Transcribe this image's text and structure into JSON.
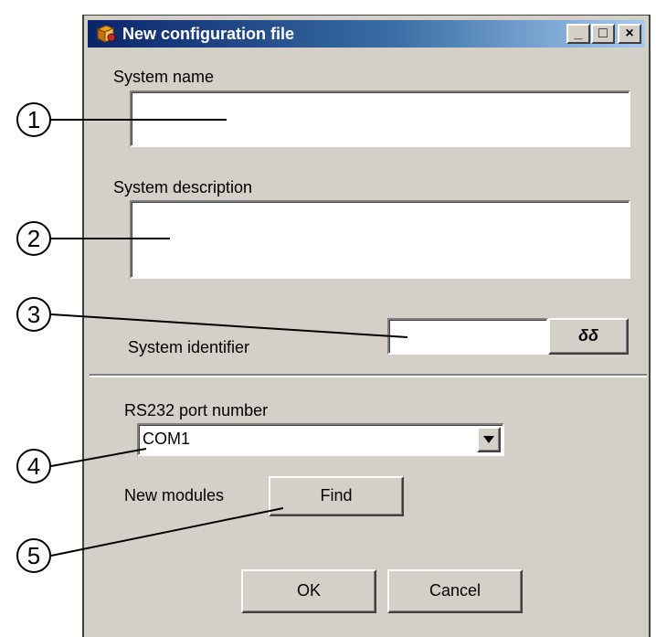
{
  "window": {
    "title": "New configuration file",
    "minimize_glyph": "_",
    "maximize_glyph": "□",
    "close_glyph": "×"
  },
  "form": {
    "system_name_label": "System name",
    "system_name_value": "",
    "system_description_label": "System description",
    "system_description_value": "",
    "system_identifier_label": "System identifier",
    "system_identifier_value": "",
    "browse_button_icon": "binoculars-icon",
    "browse_button_glyph": "δδ",
    "port_label": "RS232 port number",
    "port_selected": "COM1",
    "new_modules_label": "New modules",
    "find_button": "Find",
    "ok_button": "OK",
    "cancel_button": "Cancel"
  },
  "callouts": [
    "1",
    "2",
    "3",
    "4",
    "5"
  ],
  "colors": {
    "dialog_face": "#d4d0c8",
    "title_start": "#0a246a",
    "title_end": "#a6caf0"
  }
}
